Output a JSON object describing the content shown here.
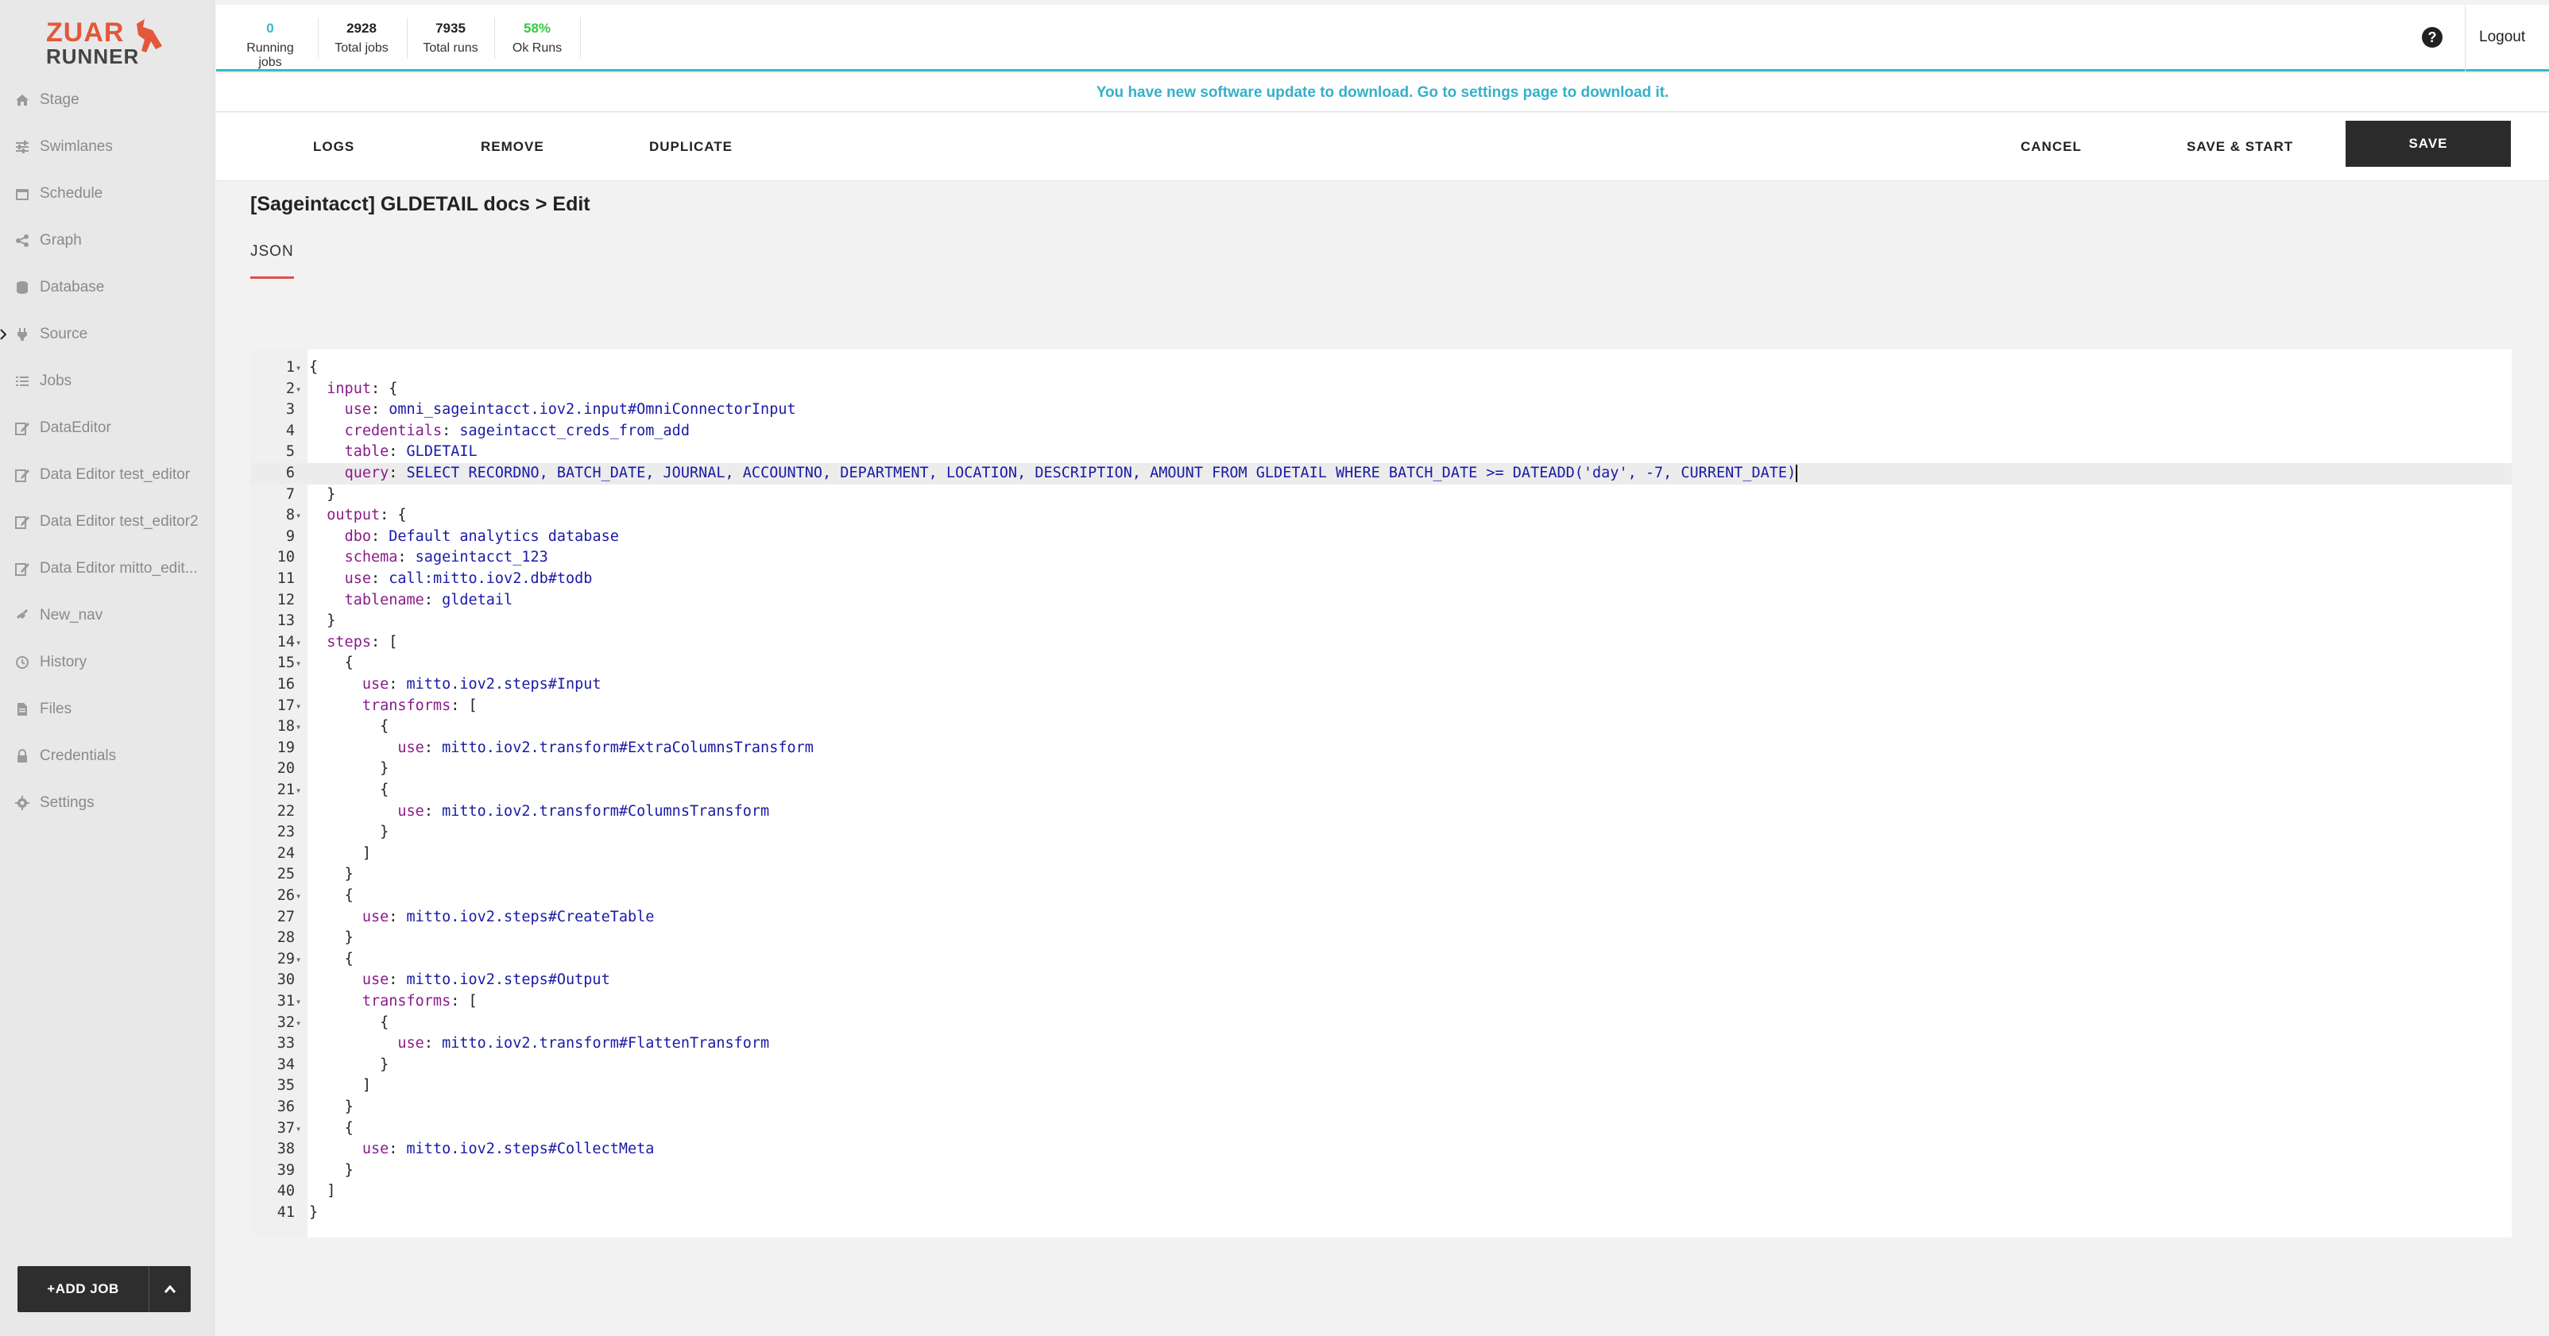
{
  "app": {
    "logo_line1": "ZUAR",
    "logo_line2": "RUNNER",
    "accent": "#e3573b",
    "highlight": "#35b9cf"
  },
  "stats": [
    {
      "value": "0",
      "label": "Running jobs",
      "color": "#35b9cf"
    },
    {
      "value": "2928",
      "label": "Total jobs",
      "color": "#222222"
    },
    {
      "value": "7935",
      "label": "Total runs",
      "color": "#222222"
    },
    {
      "value": "58%",
      "label": "Ok Runs",
      "color": "#2ecc40"
    }
  ],
  "header": {
    "logout": "Logout",
    "help_icon": "?"
  },
  "banner": "You have new software update to download. Go to settings page to download it.",
  "sidebar": {
    "items": [
      {
        "label": "Stage",
        "icon": "home-icon"
      },
      {
        "label": "Swimlanes",
        "icon": "sliders-icon"
      },
      {
        "label": "Schedule",
        "icon": "calendar-icon"
      },
      {
        "label": "Graph",
        "icon": "share-icon"
      },
      {
        "label": "Database",
        "icon": "database-icon"
      },
      {
        "label": "Source",
        "icon": "plug-icon"
      },
      {
        "label": "Jobs",
        "icon": "list-icon"
      },
      {
        "label": "DataEditor",
        "icon": "edit-icon"
      },
      {
        "label": "Data Editor test_editor",
        "icon": "edit-icon"
      },
      {
        "label": "Data Editor test_editor2",
        "icon": "edit-icon"
      },
      {
        "label": "Data Editor mitto_edit...",
        "icon": "edit-icon"
      },
      {
        "label": "New_nav",
        "icon": "link-icon"
      },
      {
        "label": "History",
        "icon": "history-icon"
      },
      {
        "label": "Files",
        "icon": "file-icon"
      },
      {
        "label": "Credentials",
        "icon": "lock-icon"
      },
      {
        "label": "Settings",
        "icon": "gear-icon"
      }
    ],
    "add_job": "+ADD JOB"
  },
  "toolbar": {
    "logs": "LOGS",
    "remove": "REMOVE",
    "duplicate": "DUPLICATE",
    "cancel": "CANCEL",
    "save_start": "SAVE & START",
    "save": "SAVE"
  },
  "page": {
    "title": "[Sageintacct] GLDETAIL docs > Edit",
    "tab": "JSON"
  },
  "editor": {
    "active_line": 6,
    "lines": [
      {
        "n": "1",
        "fold": true,
        "indent": 0,
        "key": "",
        "val": "{"
      },
      {
        "n": "2",
        "fold": true,
        "indent": 1,
        "key": "input",
        "val": "{",
        "valtype": "p"
      },
      {
        "n": "3",
        "fold": false,
        "indent": 2,
        "key": "use",
        "val": "omni_sageintacct.iov2.input#OmniConnectorInput"
      },
      {
        "n": "4",
        "fold": false,
        "indent": 2,
        "key": "credentials",
        "val": "sageintacct_creds_from_add"
      },
      {
        "n": "5",
        "fold": false,
        "indent": 2,
        "key": "table",
        "val": "GLDETAIL"
      },
      {
        "n": "6",
        "fold": false,
        "indent": 2,
        "key": "query",
        "val": "SELECT RECORDNO, BATCH_DATE, JOURNAL, ACCOUNTNO, DEPARTMENT, LOCATION, DESCRIPTION, AMOUNT FROM GLDETAIL WHERE BATCH_DATE >= DATEADD('day', -7, CURRENT_DATE)"
      },
      {
        "n": "7",
        "fold": false,
        "indent": 1,
        "key": "",
        "val": "}"
      },
      {
        "n": "8",
        "fold": true,
        "indent": 1,
        "key": "output",
        "val": "{",
        "valtype": "p"
      },
      {
        "n": "9",
        "fold": false,
        "indent": 2,
        "key": "dbo",
        "val": "Default analytics database"
      },
      {
        "n": "10",
        "fold": false,
        "indent": 2,
        "key": "schema",
        "val": "sageintacct_123"
      },
      {
        "n": "11",
        "fold": false,
        "indent": 2,
        "key": "use",
        "val": "call:mitto.iov2.db#todb"
      },
      {
        "n": "12",
        "fold": false,
        "indent": 2,
        "key": "tablename",
        "val": "gldetail"
      },
      {
        "n": "13",
        "fold": false,
        "indent": 1,
        "key": "",
        "val": "}"
      },
      {
        "n": "14",
        "fold": true,
        "indent": 1,
        "key": "steps",
        "val": "[",
        "valtype": "p"
      },
      {
        "n": "15",
        "fold": true,
        "indent": 2,
        "key": "",
        "val": "{"
      },
      {
        "n": "16",
        "fold": false,
        "indent": 3,
        "key": "use",
        "val": "mitto.iov2.steps#Input"
      },
      {
        "n": "17",
        "fold": true,
        "indent": 3,
        "key": "transforms",
        "val": "[",
        "valtype": "p"
      },
      {
        "n": "18",
        "fold": true,
        "indent": 4,
        "key": "",
        "val": "{"
      },
      {
        "n": "19",
        "fold": false,
        "indent": 5,
        "key": "use",
        "val": "mitto.iov2.transform#ExtraColumnsTransform"
      },
      {
        "n": "20",
        "fold": false,
        "indent": 4,
        "key": "",
        "val": "}"
      },
      {
        "n": "21",
        "fold": true,
        "indent": 4,
        "key": "",
        "val": "{"
      },
      {
        "n": "22",
        "fold": false,
        "indent": 5,
        "key": "use",
        "val": "mitto.iov2.transform#ColumnsTransform"
      },
      {
        "n": "23",
        "fold": false,
        "indent": 4,
        "key": "",
        "val": "}"
      },
      {
        "n": "24",
        "fold": false,
        "indent": 3,
        "key": "",
        "val": "]"
      },
      {
        "n": "25",
        "fold": false,
        "indent": 2,
        "key": "",
        "val": "}"
      },
      {
        "n": "26",
        "fold": true,
        "indent": 2,
        "key": "",
        "val": "{"
      },
      {
        "n": "27",
        "fold": false,
        "indent": 3,
        "key": "use",
        "val": "mitto.iov2.steps#CreateTable"
      },
      {
        "n": "28",
        "fold": false,
        "indent": 2,
        "key": "",
        "val": "}"
      },
      {
        "n": "29",
        "fold": true,
        "indent": 2,
        "key": "",
        "val": "{"
      },
      {
        "n": "30",
        "fold": false,
        "indent": 3,
        "key": "use",
        "val": "mitto.iov2.steps#Output"
      },
      {
        "n": "31",
        "fold": true,
        "indent": 3,
        "key": "transforms",
        "val": "[",
        "valtype": "p"
      },
      {
        "n": "32",
        "fold": true,
        "indent": 4,
        "key": "",
        "val": "{"
      },
      {
        "n": "33",
        "fold": false,
        "indent": 5,
        "key": "use",
        "val": "mitto.iov2.transform#FlattenTransform"
      },
      {
        "n": "34",
        "fold": false,
        "indent": 4,
        "key": "",
        "val": "}"
      },
      {
        "n": "35",
        "fold": false,
        "indent": 3,
        "key": "",
        "val": "]"
      },
      {
        "n": "36",
        "fold": false,
        "indent": 2,
        "key": "",
        "val": "}"
      },
      {
        "n": "37",
        "fold": true,
        "indent": 2,
        "key": "",
        "val": "{"
      },
      {
        "n": "38",
        "fold": false,
        "indent": 3,
        "key": "use",
        "val": "mitto.iov2.steps#CollectMeta"
      },
      {
        "n": "39",
        "fold": false,
        "indent": 2,
        "key": "",
        "val": "}"
      },
      {
        "n": "40",
        "fold": false,
        "indent": 1,
        "key": "",
        "val": "]"
      },
      {
        "n": "41",
        "fold": false,
        "indent": 0,
        "key": "",
        "val": "}"
      }
    ]
  }
}
